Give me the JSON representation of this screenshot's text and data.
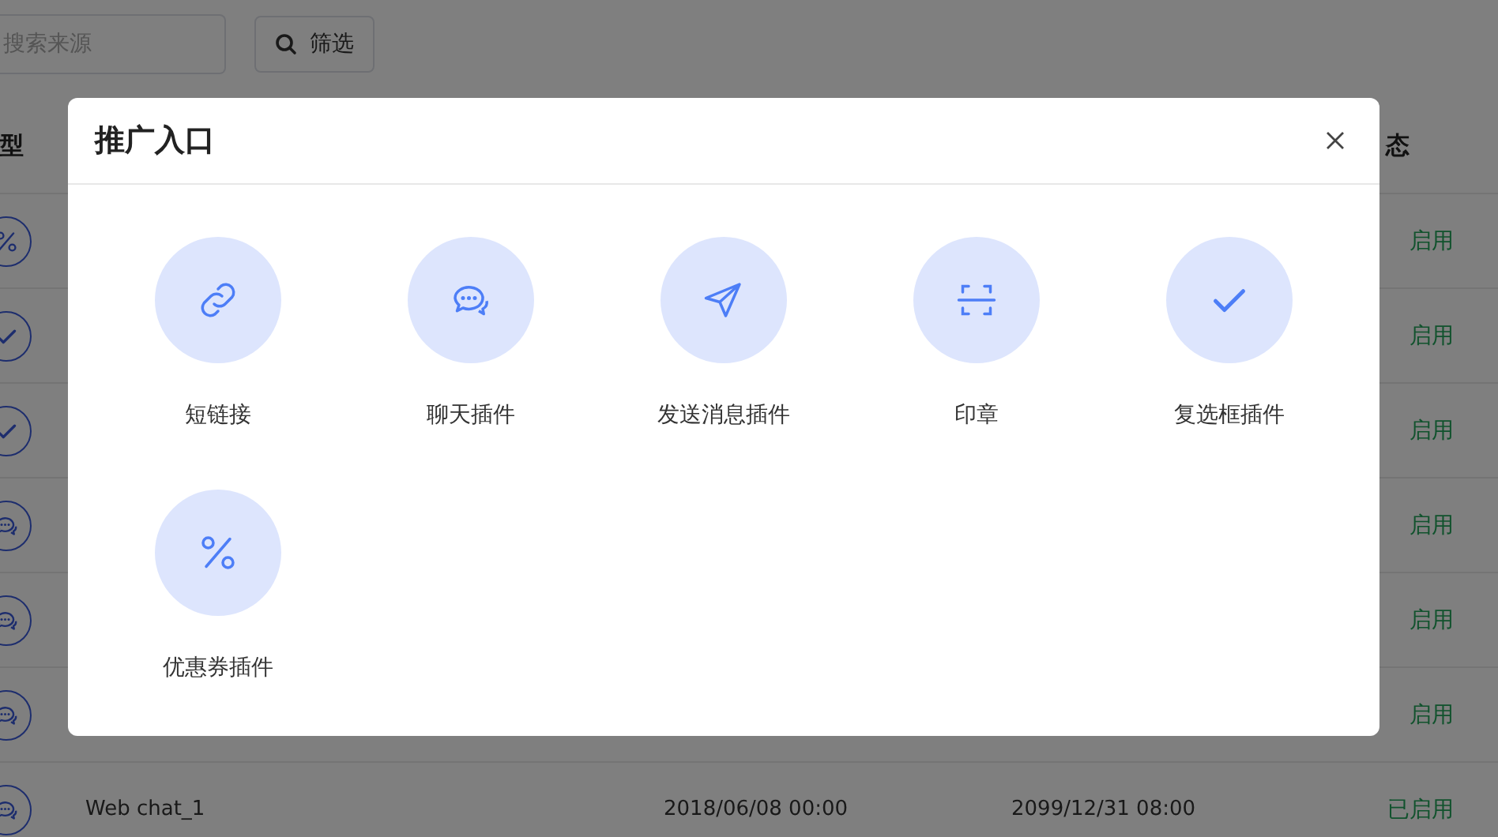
{
  "toolbar": {
    "search": {
      "placeholder": "搜索来源"
    },
    "filter_button": "筛选"
  },
  "table": {
    "columns": [
      {
        "label": "型"
      },
      {
        "label": "态"
      }
    ],
    "rows": [
      {
        "kind": "percent",
        "status": "启用"
      },
      {
        "kind": "check",
        "status": "启用"
      },
      {
        "kind": "check",
        "status": "启用"
      },
      {
        "kind": "chat",
        "status": "启用"
      },
      {
        "kind": "chat",
        "status": "启用"
      },
      {
        "kind": "chat",
        "status": "启用"
      },
      {
        "kind": "chat",
        "name": "Web chat_1",
        "start": "2018/06/08 00:00",
        "end": "2099/12/31 08:00",
        "status": "已启用"
      }
    ]
  },
  "dialog": {
    "title": "推广入口",
    "items": [
      {
        "kind": "link",
        "label": "短链接"
      },
      {
        "kind": "chat",
        "label": "聊天插件"
      },
      {
        "kind": "send",
        "label": "发送消息插件"
      },
      {
        "kind": "scan",
        "label": "印章"
      },
      {
        "kind": "check",
        "label": "复选框插件"
      },
      {
        "kind": "percent",
        "label": "优惠券插件"
      }
    ]
  }
}
